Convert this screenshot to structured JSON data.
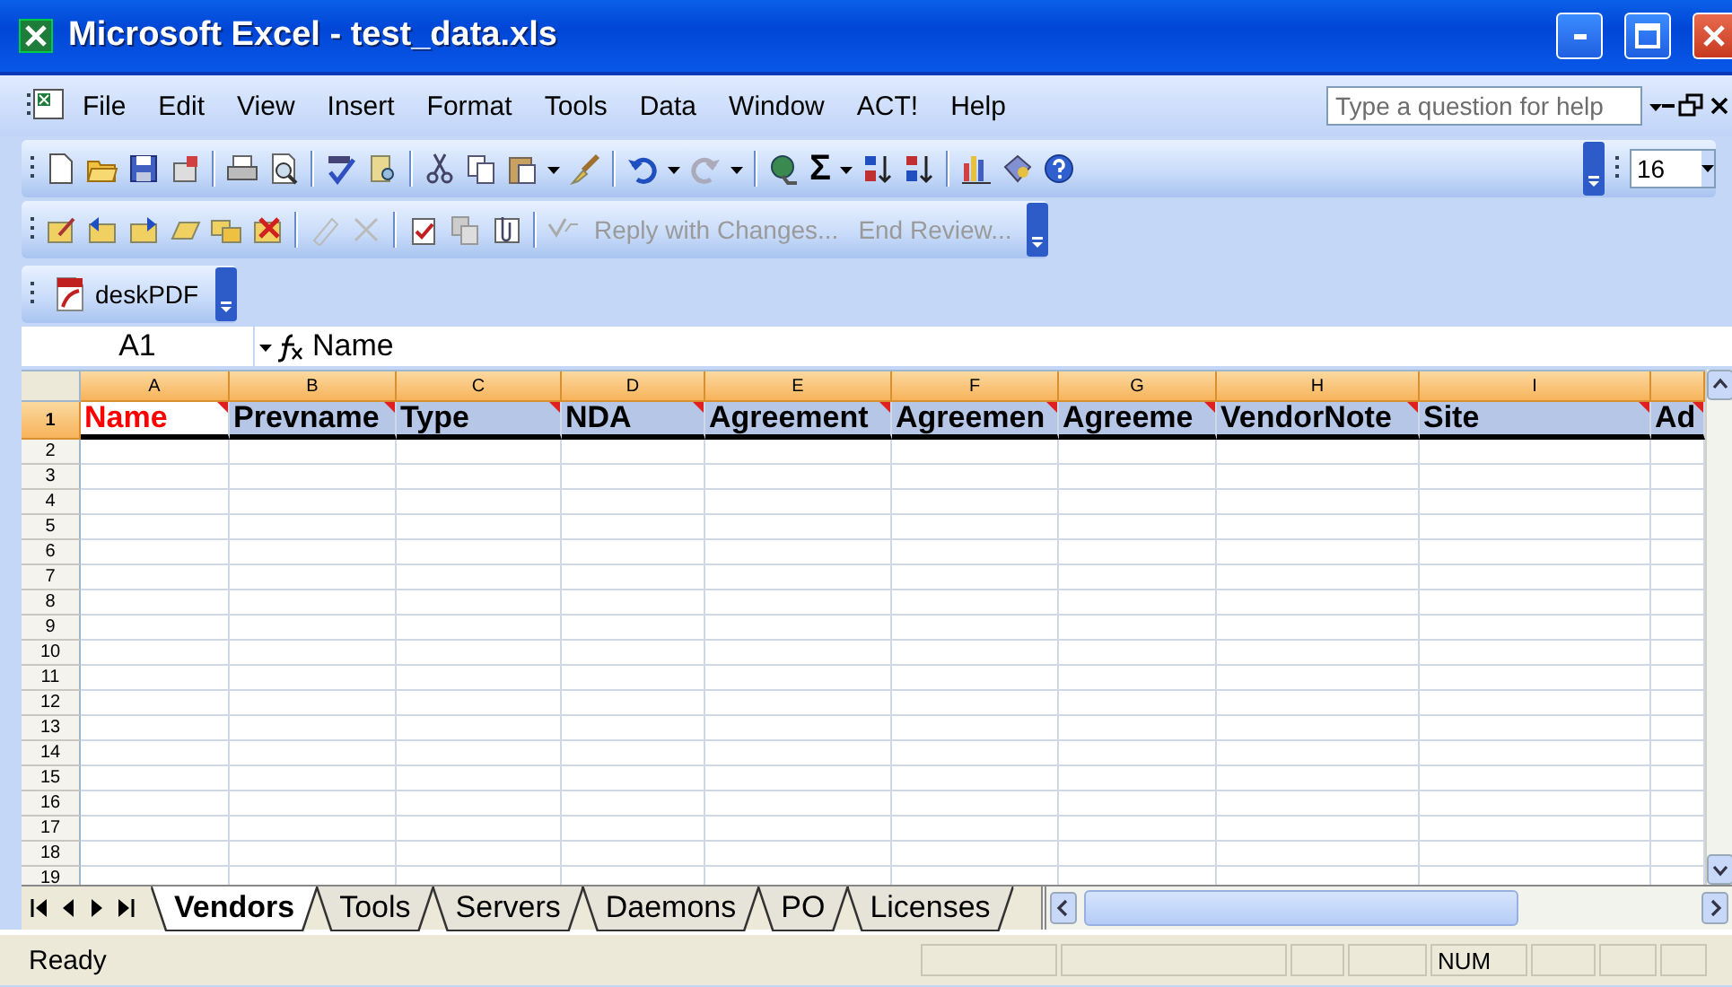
{
  "window": {
    "title": "Microsoft Excel - test_data.xls"
  },
  "menu": [
    "File",
    "Edit",
    "View",
    "Insert",
    "Format",
    "Tools",
    "Data",
    "Window",
    "ACT!",
    "Help"
  ],
  "help_box": {
    "placeholder": "Type a question for help"
  },
  "standard_toolbar": {
    "autosum": "Σ",
    "font_size": "16"
  },
  "review_toolbar": {
    "buttons": [
      {
        "label": "Reply with Changes...",
        "disabled": true
      },
      {
        "label": "End Review...",
        "disabled": true
      }
    ]
  },
  "deskpdf_toolbar": {
    "label": "deskPDF"
  },
  "formula_bar": {
    "cell_ref": "A1",
    "formula": "Name"
  },
  "sheet": {
    "columns": [
      "A",
      "B",
      "C",
      "D",
      "E",
      "F",
      "G",
      "H",
      "I"
    ],
    "header_row": [
      {
        "text": "Name",
        "color": "#ff0000",
        "selected": true
      },
      {
        "text": "Prevname",
        "color": "#000000",
        "selected": false
      },
      {
        "text": "Type",
        "color": "#000000",
        "selected": false
      },
      {
        "text": "NDA",
        "color": "#000000",
        "selected": false
      },
      {
        "text": "Agreement",
        "color": "#000000",
        "selected": false
      },
      {
        "text": "Agreemen",
        "color": "#000000",
        "selected": false
      },
      {
        "text": "Agreeme",
        "color": "#000000",
        "selected": false
      },
      {
        "text": "VendorNote",
        "color": "#000000",
        "selected": false
      },
      {
        "text": "Site",
        "color": "#000000",
        "selected": false
      },
      {
        "text": "Ad",
        "color": "#000000",
        "selected": false
      }
    ],
    "row_numbers": [
      "1",
      "2",
      "3",
      "4",
      "5",
      "6",
      "7",
      "8",
      "9",
      "10",
      "11",
      "12",
      "13",
      "14",
      "15",
      "16",
      "17",
      "18",
      "19"
    ]
  },
  "sheet_tabs": [
    {
      "label": "Vendors",
      "selected": true
    },
    {
      "label": "Tools",
      "selected": false
    },
    {
      "label": "Servers",
      "selected": false
    },
    {
      "label": "Daemons",
      "selected": false
    },
    {
      "label": "PO",
      "selected": false
    },
    {
      "label": "Licenses",
      "selected": false
    }
  ],
  "status_bar": {
    "text": "Ready",
    "num": "NUM"
  }
}
